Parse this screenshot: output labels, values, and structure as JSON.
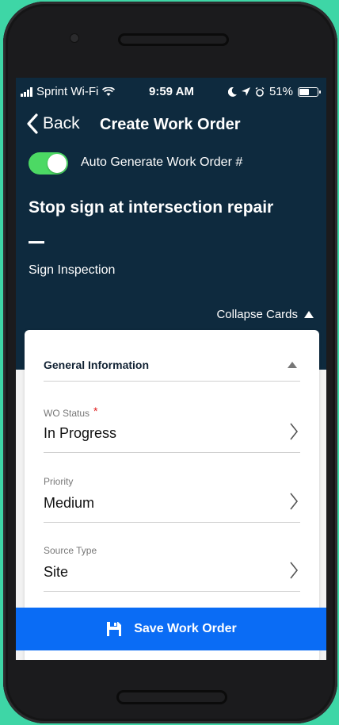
{
  "status_bar": {
    "carrier": "Sprint Wi-Fi",
    "time": "9:59 AM",
    "battery": "51%",
    "battery_level": 0.51
  },
  "nav": {
    "back_label": "Back",
    "title": "Create Work Order"
  },
  "header": {
    "toggle_on": true,
    "toggle_label": "Auto Generate Work Order #",
    "work_order_title": "Stop sign at intersection repair",
    "subtitle": "Sign Inspection",
    "collapse_label": "Collapse Cards"
  },
  "card": {
    "title": "General Information",
    "fields": [
      {
        "label": "WO Status",
        "required_mark": "*",
        "value": "In Progress"
      },
      {
        "label": "Priority",
        "value": "Medium"
      },
      {
        "label": "Source Type",
        "value": "Site"
      }
    ]
  },
  "footer": {
    "save_label": "Save Work Order"
  },
  "colors": {
    "header_bg": "#0e2a3e",
    "toggle_on": "#4cd964",
    "save_button": "#0a6cf5",
    "phone_background": "#3ed6a6",
    "required": "#e02020"
  },
  "icons": [
    "signal-icon",
    "wifi-icon",
    "moon-icon",
    "location-arrow-icon",
    "alarm-icon",
    "battery-icon",
    "back-chevron-icon",
    "caret-up-icon",
    "chevron-right-icon",
    "save-disk-icon"
  ]
}
